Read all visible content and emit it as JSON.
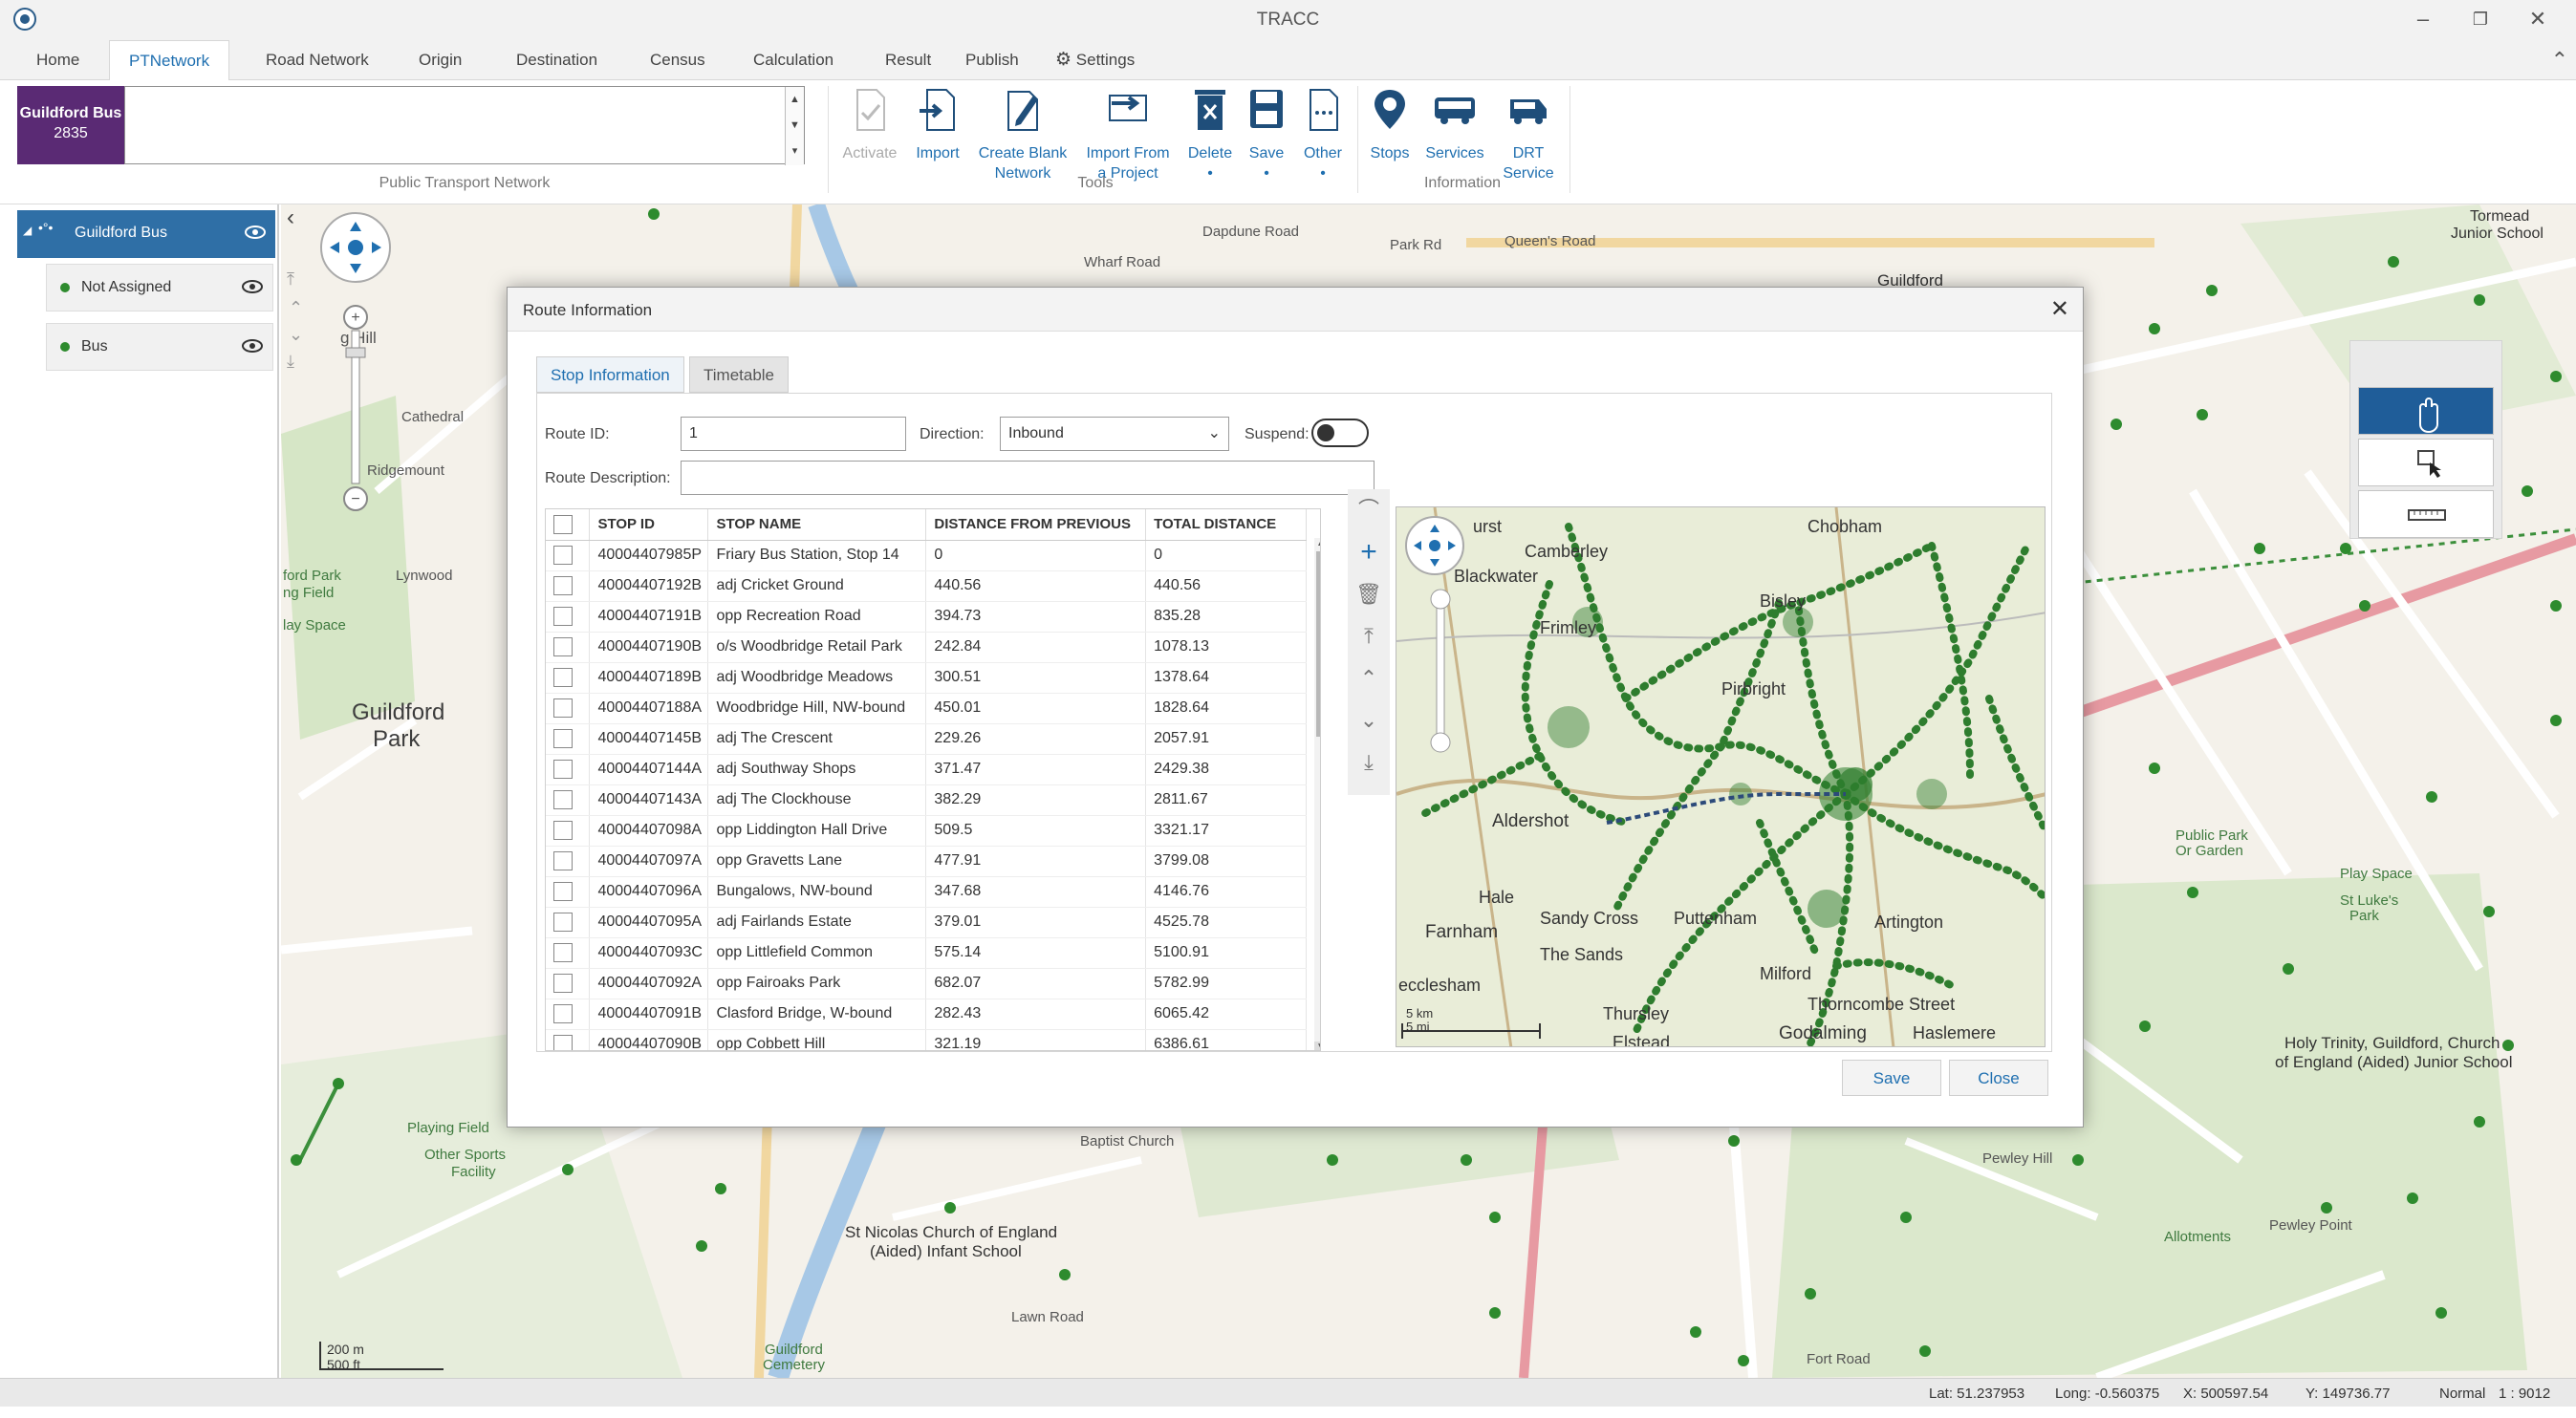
{
  "app": {
    "title": "TRACC"
  },
  "menu": {
    "tabs": [
      "Home",
      "PTNetwork",
      "Road Network",
      "Origin",
      "Destination",
      "Census",
      "Calculation",
      "Result",
      "Publish",
      "Settings"
    ],
    "active": "PTNetwork"
  },
  "ribbon": {
    "network_tile": {
      "name": "Guildford Bus",
      "id": "2835",
      "color": "#5a2a74"
    },
    "groups": {
      "network": "Public Transport Network",
      "tools": "Tools",
      "information": "Information"
    },
    "buttons": {
      "activate": "Activate",
      "import": "Import",
      "create_blank_1": "Create Blank",
      "create_blank_2": "Network",
      "import_from_1": "Import From",
      "import_from_2": "a Project",
      "delete": "Delete",
      "save": "Save",
      "other": "Other",
      "stops": "Stops",
      "services": "Services",
      "drt_1": "DRT",
      "drt_2": "Service"
    }
  },
  "tree": {
    "root": "Guildford Bus",
    "items": [
      "Not Assigned",
      "Bus"
    ]
  },
  "map": {
    "labels": {
      "guildford_park": "Guildford",
      "guildford_park_2": "Park",
      "wharf_road": "Wharf Road",
      "dapdune_road": "Dapdune Road",
      "park_road": "Park Rd",
      "queens_road": "Queen's Road",
      "guildford": "Guildford",
      "ridgemount": "Ridgemount",
      "hill": "g Hill",
      "ford_park": "ford Park",
      "playing_field": "ng Field",
      "play_space": "lay Space",
      "lynwood": "Lynwood",
      "cathedral": "Cathedral",
      "playing_field_2": "Playing Field",
      "other_sports": "Other Sports",
      "facility": "Facility",
      "baptist_church": "Baptist Church",
      "st_nicolas_1": "St Nicolas Church of England",
      "st_nicolas_2": "(Aided) Infant School",
      "holy_trinity_1": "Holy Trinity, Guildford, Church",
      "holy_trinity_2": "of England (Aided) Junior School",
      "allotments": "Allotments",
      "pewley_hill": "Pewley Hill",
      "pewley_point": "Pewley Point",
      "public_park_1": "Public Park",
      "public_park_2": "Or Garden",
      "play_space_2": "Play Space",
      "st_lukes_1": "St Luke's",
      "st_lukes_2": "Park",
      "tormead_1": "Tormead",
      "tormead_2": "Junior School",
      "guildford_cemetery_1": "Guildford",
      "guildford_cemetery_2": "Cemetery",
      "lawn_road": "Lawn Road",
      "fort_road": "Fort Road",
      "scale_m": "200 m",
      "scale_ft": "500 ft"
    }
  },
  "dialog": {
    "title": "Route Information",
    "tabs": [
      "Stop Information",
      "Timetable"
    ],
    "route_id_label": "Route ID:",
    "route_id": "1",
    "direction_label": "Direction:",
    "direction": "Inbound",
    "suspend_label": "Suspend:",
    "route_desc_label": "Route Description:",
    "route_desc": "",
    "columns": [
      "STOP ID",
      "STOP NAME",
      "DISTANCE FROM PREVIOUS",
      "TOTAL DISTANCE"
    ],
    "rows": [
      [
        "40004407985P",
        "Friary Bus Station, Stop 14",
        "0",
        "0"
      ],
      [
        "40004407192B",
        "adj Cricket Ground",
        "440.56",
        "440.56"
      ],
      [
        "40004407191B",
        "opp Recreation Road",
        "394.73",
        "835.28"
      ],
      [
        "40004407190B",
        "o/s Woodbridge Retail Park",
        "242.84",
        "1078.13"
      ],
      [
        "40004407189B",
        "adj Woodbridge Meadows",
        "300.51",
        "1378.64"
      ],
      [
        "40004407188A",
        "Woodbridge Hill, NW-bound",
        "450.01",
        "1828.64"
      ],
      [
        "40004407145B",
        "adj The Crescent",
        "229.26",
        "2057.91"
      ],
      [
        "40004407144A",
        "adj Southway Shops",
        "371.47",
        "2429.38"
      ],
      [
        "40004407143A",
        "adj The Clockhouse",
        "382.29",
        "2811.67"
      ],
      [
        "40004407098A",
        "opp Liddington Hall Drive",
        "509.5",
        "3321.17"
      ],
      [
        "40004407097A",
        "opp Gravetts Lane",
        "477.91",
        "3799.08"
      ],
      [
        "40004407096A",
        "Bungalows, NW-bound",
        "347.68",
        "4146.76"
      ],
      [
        "40004407095A",
        "adj Fairlands Estate",
        "379.01",
        "4525.78"
      ],
      [
        "40004407093C",
        "opp Littlefield Common",
        "575.14",
        "5100.91"
      ],
      [
        "40004407092A",
        "opp Fairoaks Park",
        "682.07",
        "5782.99"
      ],
      [
        "40004407091B",
        "Clasford Bridge, W-bound",
        "282.43",
        "6065.42"
      ],
      [
        "40004407090B",
        "opp Cobbett Hill",
        "321.19",
        "6386.61"
      ]
    ],
    "mini_map_labels": {
      "camberley": "Camberley",
      "blackwater": "Blackwater",
      "frimley": "Frimley",
      "chobham": "Chobham",
      "bisley": "Bisley",
      "pirbright": "Pirbright",
      "aldershot": "Aldershot",
      "farnham": "Farnham",
      "the_sands": "The Sands",
      "sandy_cross": "Sandy Cross",
      "puttenham": "Puttenham",
      "godalming": "Godalming",
      "thursley": "Thursley",
      "haslemere": "Haslemere",
      "elstead": "Elstead",
      "milford": "Milford",
      "thorncombe": "Thorncombe Street",
      "artington": "Artington",
      "hale": "Hale",
      "urst": "urst",
      "ecclesham": "ecclesham",
      "scale_km": "5 km",
      "scale_mi": "5 mi"
    },
    "save": "Save",
    "close": "Close"
  },
  "status": {
    "lat": "Lat: 51.237953",
    "long": "Long: -0.560375",
    "x": "X: 500597.54",
    "y": "Y: 149736.77",
    "mode": "Normal",
    "scale": "1 : 9012"
  },
  "colors": {
    "accent": "#1f6fb0",
    "tree_selected": "#2f6fa6",
    "stop_dot": "#2e8b2e",
    "route_green": "#3b8f3b"
  }
}
